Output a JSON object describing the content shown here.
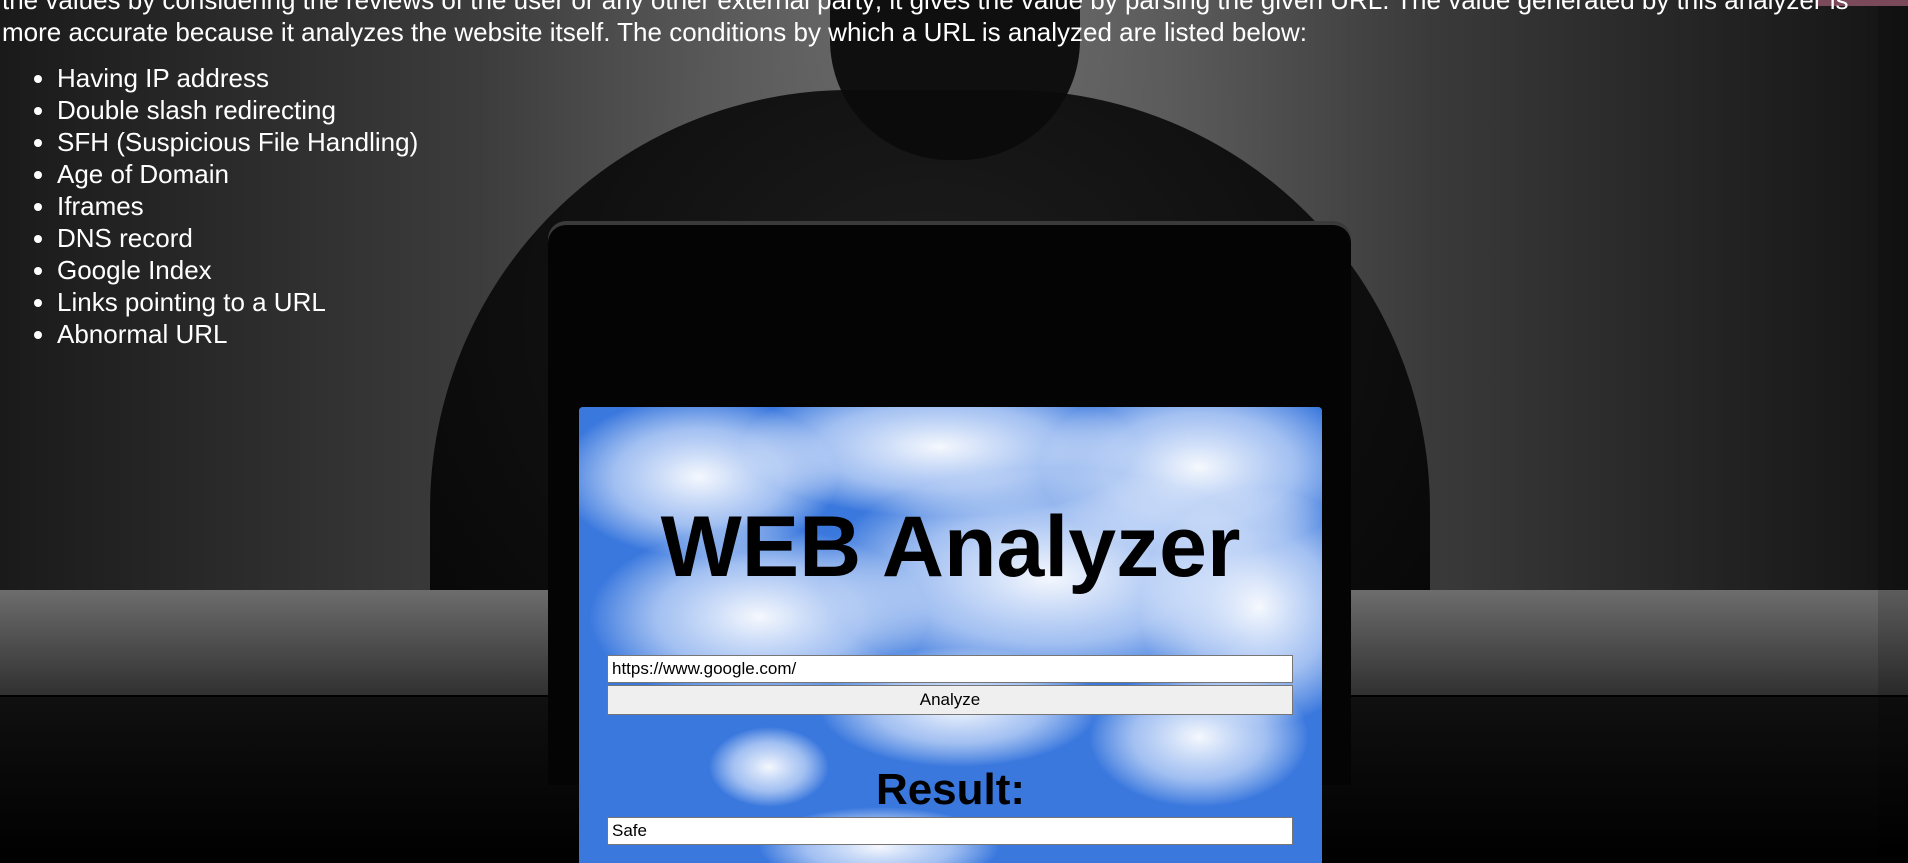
{
  "intro": {
    "text": "the values by considering the reviews of the user or any other external party; it gives the value by parsing the given URL. The value generated by this analyzer is more accurate because it analyzes the website itself. The conditions by which a URL is analyzed are listed below:"
  },
  "criteria": [
    "Having IP address",
    "Double slash redirecting",
    "SFH (Suspicious File Handling)",
    "Age of Domain",
    "Iframes",
    "DNS record",
    "Google Index",
    "Links pointing to a URL",
    "Abnormal URL"
  ],
  "analyzer": {
    "title": "WEB Analyzer",
    "url_value": "https://www.google.com/",
    "analyze_label": "Analyze",
    "result_label": "Result:",
    "result_value": "Safe"
  }
}
